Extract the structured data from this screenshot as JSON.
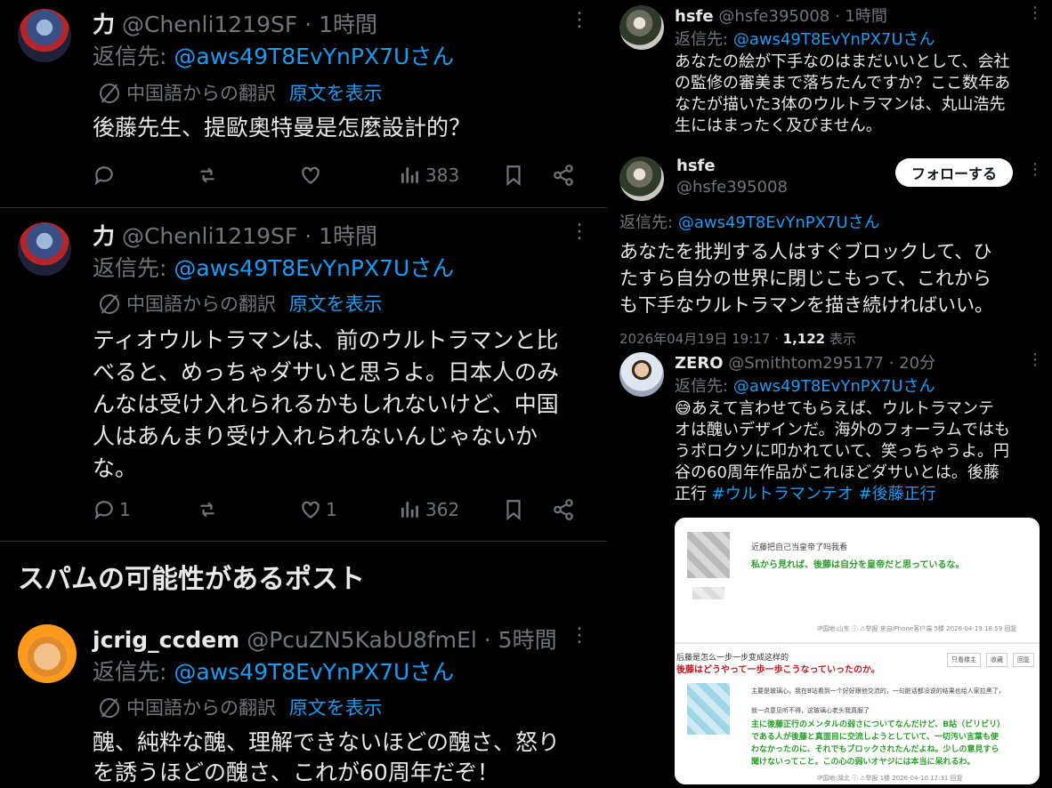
{
  "left": {
    "tweet1": {
      "name": "力",
      "handle_time": "@Chenli1219SF · 1時間",
      "reply_prefix": "返信先:",
      "reply_to": "@aws49T8EvYnPX7Uさん",
      "translation_label": "中国語からの翻訳",
      "show_original": "原文を表示",
      "text": "後藤先生、提歐奧特曼是怎麼設計的？",
      "views": "383"
    },
    "tweet2": {
      "name": "力",
      "handle_time": "@Chenli1219SF · 1時間",
      "reply_prefix": "返信先:",
      "reply_to": "@aws49T8EvYnPX7Uさん",
      "translation_label": "中国語からの翻訳",
      "show_original": "原文を表示",
      "lines": [
        "ティオウルトラマンは、前のウルトラマンと比",
        "べると、めっちゃダサいと思うよ。日本人のみ",
        "んなは受け入れられるかもしれないけど、中国",
        "人はあんまり受け入れられないんじゃないか",
        "な。"
      ],
      "replies": "1",
      "likes": "1",
      "views": "362"
    },
    "spam_heading": "スパムの可能性があるポスト",
    "tweet3": {
      "name": "jcrig_ccdem",
      "handle_time": "@PcuZN5KabU8fmEl · 5時間",
      "reply_prefix": "返信先:",
      "reply_to": "@aws49T8EvYnPX7Uさん",
      "translation_label": "中国語からの翻訳",
      "show_original": "原文を表示",
      "lines": [
        "醜、純粋な醜、理解できないほどの醜さ、怒り",
        "を誘うほどの醜さ、これが60周年だぞ！"
      ]
    }
  },
  "right": {
    "reply1": {
      "name": "hsfe",
      "handle_time": "@hsfe395008 · 1時間",
      "reply_prefix": "返信先:",
      "reply_to": "@aws49T8EvYnPX7Uさん",
      "lines": [
        "あなたの絵が下手なのはまだいいとして、会社",
        "の監修の審美まで落ちたんですか？ここ数年あ",
        "なたが描いた3体のウルトラマンは、丸山浩先",
        "生にはまったく及びません。"
      ]
    },
    "main": {
      "name": "hsfe",
      "handle": "@hsfe395008",
      "follow_label": "フォローする",
      "reply_prefix": "返信先:",
      "reply_to": "@aws49T8EvYnPX7Uさん",
      "lines": [
        "あなたを批判する人はすぐブロックして、ひ",
        "たすら自分の世界に閉じこもって、これから",
        "も下手なウルトラマンを描き続ければいい。"
      ],
      "timestamp": "2026年04月19日 19:17 · ",
      "views_count": "1,122",
      "views_label": " 表示"
    },
    "reply2": {
      "name": "ZERO",
      "handle_time": "@Smithtom295177 · 20分",
      "reply_prefix": "返信先:",
      "reply_to": "@aws49T8EvYnPX7Uさん",
      "lines": [
        "😅あえて言わせてもらえば、ウルトラマンテ",
        "オは醜いデザインだ。海外のフォーラムではも",
        "うボロクソに叩かれていて、笑っちゃうよ。円",
        "谷の60周年作品がこれほどダサいとは。後藤"
      ],
      "last_line_plain": "正行 ",
      "hashtag1": "#ウルトラマンテオ",
      "hashtag2": "#後藤正行",
      "card": {
        "top_caption": "近藤把自己当皇帝了吗我看",
        "top_green": "私から見れば、後藤は自分を皇帝だと思っているな。",
        "top_footer": "IP国地:山东 ⓘ ⚠举报 来自iPhone客户端 5楼 2026-04-19 18:59 回复",
        "mid_title": "后藤是怎么一步一步变成这样的",
        "mid_red": "後藤はどうやって一歩一歩こうなっていったのか。",
        "mid_buttons": [
          "只看楼主",
          "收藏",
          "回复"
        ],
        "body_line1": "主要是玻璃心，我在B站看到一个好好跟他交流的，一句脏话都没说的结果也给人家拉黑了，",
        "body_line2": "就一点意见听不得，这玻璃心老头我真服了",
        "green_lines": [
          "主に後藤正行のメンタルの弱さについてなんだけど、B站（ビリビリ）",
          "である人が後藤と真面目に交流しようとしていて、一切汚い言葉も使",
          "わなかったのに、それでもブロックされたんだよね。少しの意見すら",
          "聞けないってこと。この心の弱いオヤジには本当に呆れるわ。"
        ],
        "bottom_footer": "IP国地:湖北 ⓘ ⚠举报 1楼 2026-04-10 17:31 回复"
      }
    }
  },
  "colors": {
    "background": "#000000",
    "text": "#e7e9ea",
    "muted": "#71767b",
    "link": "#1d9bf0",
    "divider": "#2f3336"
  }
}
